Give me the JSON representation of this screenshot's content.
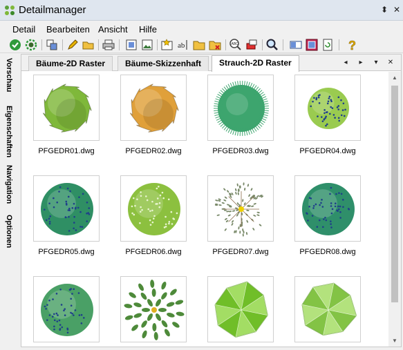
{
  "window": {
    "title": "Detailmanager",
    "pin_glyph": "⬍",
    "close_glyph": "✕"
  },
  "menu": {
    "items": [
      "Detail",
      "Bearbeiten",
      "Ansicht",
      "Hilfe"
    ]
  },
  "toolbar": {
    "icons": [
      "checkmark-icon",
      "gear-icon",
      "copy-icon",
      "pencil-icon",
      "open-folder-icon",
      "print-icon",
      "picture-frame-icon",
      "picture-icon",
      "new-picture-icon",
      "rename-icon",
      "folder-icon",
      "delete-icon",
      "abc-search-icon",
      "eraser-icon",
      "magnifier-icon",
      "layout-icon",
      "stop-icon",
      "refresh-icon",
      "help-icon"
    ]
  },
  "side_tabs": [
    "Vorschau",
    "Eigenschaften",
    "Navigation",
    "Optionen"
  ],
  "tabs": [
    {
      "label": "Bäume-2D Raster",
      "active": false
    },
    {
      "label": "Bäume-Skizzenhaft",
      "active": false
    },
    {
      "label": "Strauch-2D Raster",
      "active": true
    }
  ],
  "tab_controls": {
    "prev": "◂",
    "next": "▸",
    "menu": "▾",
    "close": "✕"
  },
  "scrollbar": {
    "up": "▲",
    "down": "▼"
  },
  "items": [
    {
      "name": "PFGEDR01.dwg",
      "style": "flower",
      "color": "#7fb83a"
    },
    {
      "name": "PFGEDR02.dwg",
      "style": "flower",
      "color": "#e0a03a"
    },
    {
      "name": "PFGEDR03.dwg",
      "style": "fuzzy",
      "color": "#3da56e"
    },
    {
      "name": "PFGEDR04.dwg",
      "style": "dotted",
      "color": "#9acb50"
    },
    {
      "name": "PFGEDR05.dwg",
      "style": "dotted",
      "color": "#2f8f64"
    },
    {
      "name": "PFGEDR06.dwg",
      "style": "dotted",
      "color": "#8cc03f"
    },
    {
      "name": "PFGEDR07.dwg",
      "style": "sketch",
      "color": "#9aa08a"
    },
    {
      "name": "PFGEDR08.dwg",
      "style": "dotted",
      "color": "#2f8f6a"
    },
    {
      "name": "",
      "style": "dotted",
      "color": "#4aa066"
    },
    {
      "name": "",
      "style": "leaves",
      "color": "#4e8a3a"
    },
    {
      "name": "",
      "style": "poly",
      "color": "#84d230"
    },
    {
      "name": "",
      "style": "poly",
      "color": "#9ad852"
    }
  ]
}
